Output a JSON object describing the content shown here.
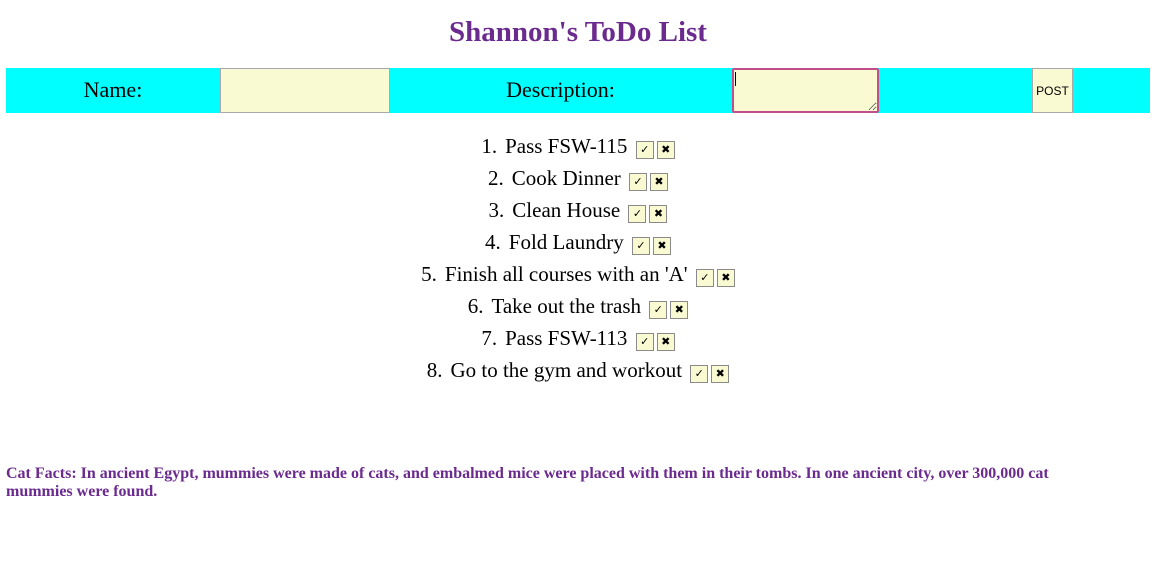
{
  "title": "Shannon's ToDo List",
  "form": {
    "name_label": "Name:",
    "name_value": "",
    "description_label": "Description:",
    "description_value": "",
    "post_label": "POST"
  },
  "todos": [
    {
      "number": "1.",
      "text": "Pass FSW-115",
      "check_icon": "✓",
      "delete_icon": "✖"
    },
    {
      "number": "2.",
      "text": "Cook Dinner",
      "check_icon": "✓",
      "delete_icon": "✖"
    },
    {
      "number": "3.",
      "text": "Clean House",
      "check_icon": "✓",
      "delete_icon": "✖"
    },
    {
      "number": "4.",
      "text": "Fold Laundry",
      "check_icon": "✓",
      "delete_icon": "✖"
    },
    {
      "number": "5.",
      "text": "Finish all courses with an 'A'",
      "check_icon": "✓",
      "delete_icon": "✖"
    },
    {
      "number": "6.",
      "text": "Take out the trash",
      "check_icon": "✓",
      "delete_icon": "✖"
    },
    {
      "number": "7.",
      "text": "Pass FSW-113",
      "check_icon": "✓",
      "delete_icon": "✖"
    },
    {
      "number": "8.",
      "text": "Go to the gym and workout",
      "check_icon": "✓",
      "delete_icon": "✖"
    }
  ],
  "cat_facts": "Cat Facts: In ancient Egypt, mummies were made of cats, and embalmed mice were placed with them in their tombs. In one ancient city, over 300,000 cat mummies were found.",
  "colors": {
    "title": "#6b2a8e",
    "form_bar": "#00ffff",
    "input_bg": "#fafad2",
    "focus_border": "#c24f8c"
  }
}
